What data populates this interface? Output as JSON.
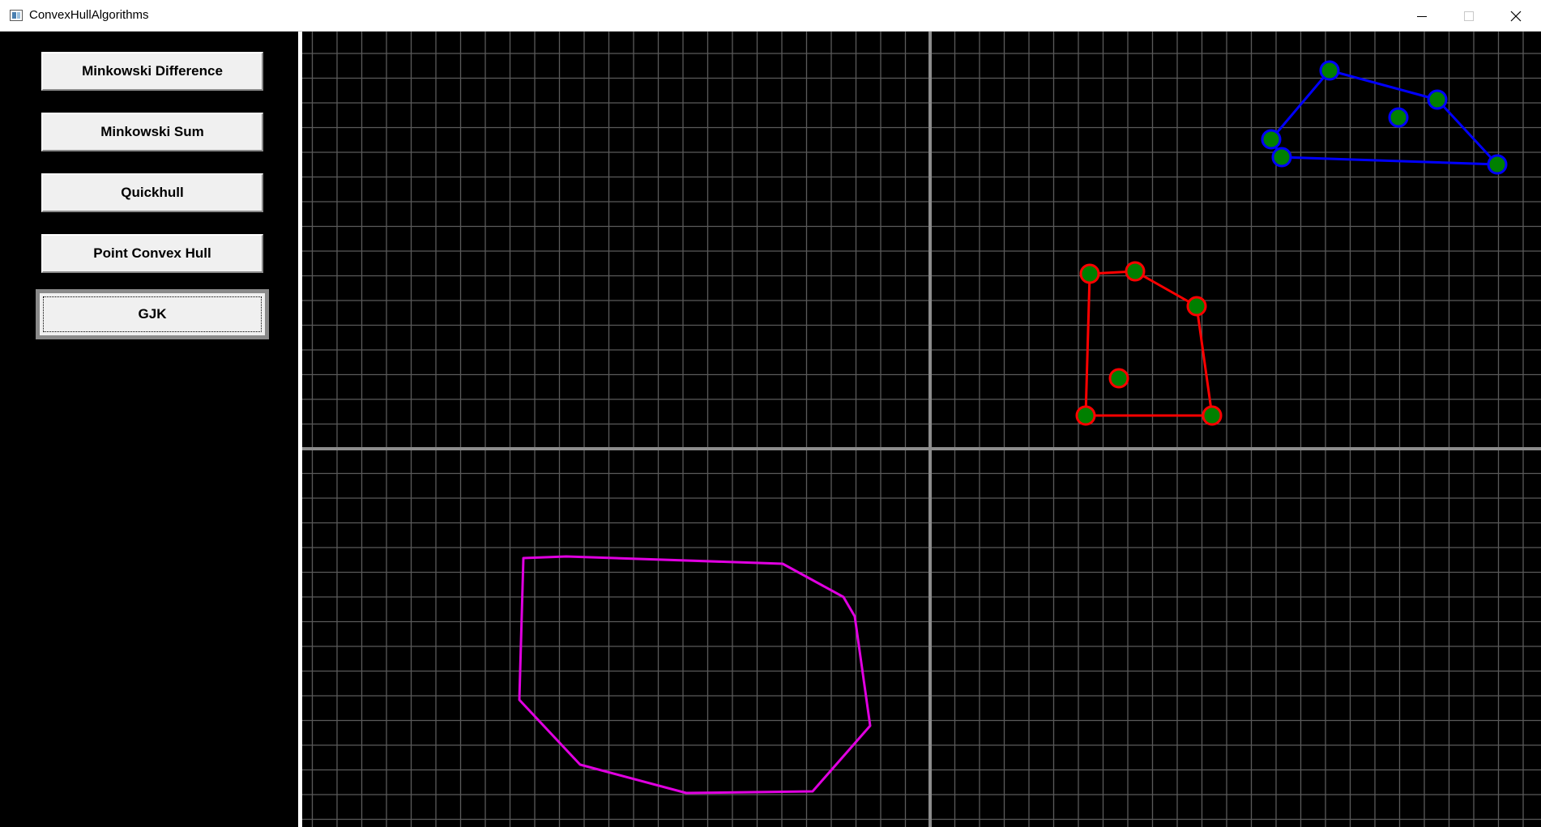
{
  "window": {
    "title": "ConvexHullAlgorithms",
    "icon": "app-window-icon",
    "controls": {
      "minimize_icon": "minimize-icon",
      "maximize_icon": "maximize-icon",
      "close_icon": "close-icon"
    }
  },
  "sidebar": {
    "buttons": [
      {
        "label": "Minkowski Difference",
        "active": false
      },
      {
        "label": "Minkowski Sum",
        "active": false
      },
      {
        "label": "Quickhull",
        "active": false
      },
      {
        "label": "Point Convex Hull",
        "active": false
      },
      {
        "label": "GJK",
        "active": true
      }
    ]
  },
  "canvas": {
    "background": "#000000",
    "grid_color": "#5a5a5a",
    "axis_color": "#8c8c8c",
    "point_fill": "#008000",
    "shapes": [
      {
        "name": "blue-hull",
        "stroke": "#0000ff",
        "points_stroke": "#0000ff",
        "hull_order": [
          0,
          1,
          2,
          3,
          4
        ]
      },
      {
        "name": "red-hull",
        "stroke": "#ff0000",
        "points_stroke": "#ff0000",
        "hull_order": [
          0,
          1,
          2,
          3,
          4
        ]
      },
      {
        "name": "magenta-hull",
        "stroke": "#e000e0"
      }
    ]
  }
}
